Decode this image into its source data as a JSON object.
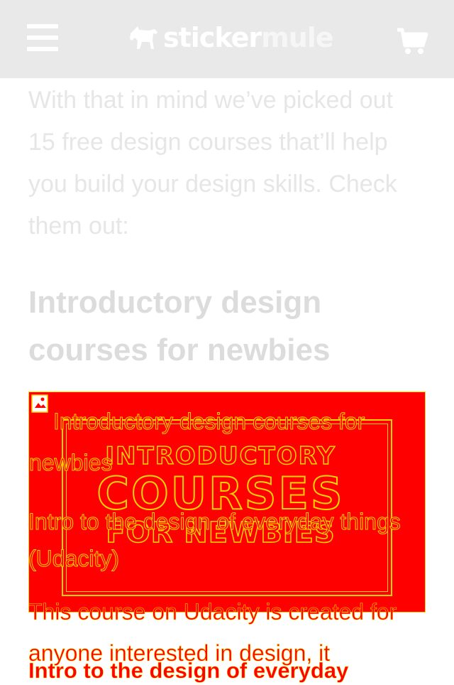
{
  "header": {
    "brand_part1": "sticker",
    "brand_part2": "mule",
    "menu_icon": "hamburger-menu-icon",
    "cart_icon": "shopping-cart-icon",
    "logo_icon": "mule-logo-icon",
    "background": "#e9e9e9"
  },
  "article": {
    "intro_paragraph": "With that in mind we’ve picked out 15 free design courses that’ll help you build your design skills. Check them out:",
    "section_heading": "Introductory design courses for newbies",
    "image": {
      "alt_text": "Introductory design courses for newbies",
      "poster_line1": "INTRODUCTORY",
      "poster_line2": "COURSES",
      "poster_line3": "FOR NEWBIES",
      "broken_icon": "broken-image-icon"
    },
    "course_link_text": "Intro to the design of everyday things (Udacity)",
    "course_description": "This course on Udacity is created for anyone interested in design, it",
    "next_heading": "Intro to the design of everyday"
  },
  "colors": {
    "highlight_red": "#ff0000",
    "highlight_outline": "#ffd400",
    "muted_text": "#e6e6e6"
  }
}
